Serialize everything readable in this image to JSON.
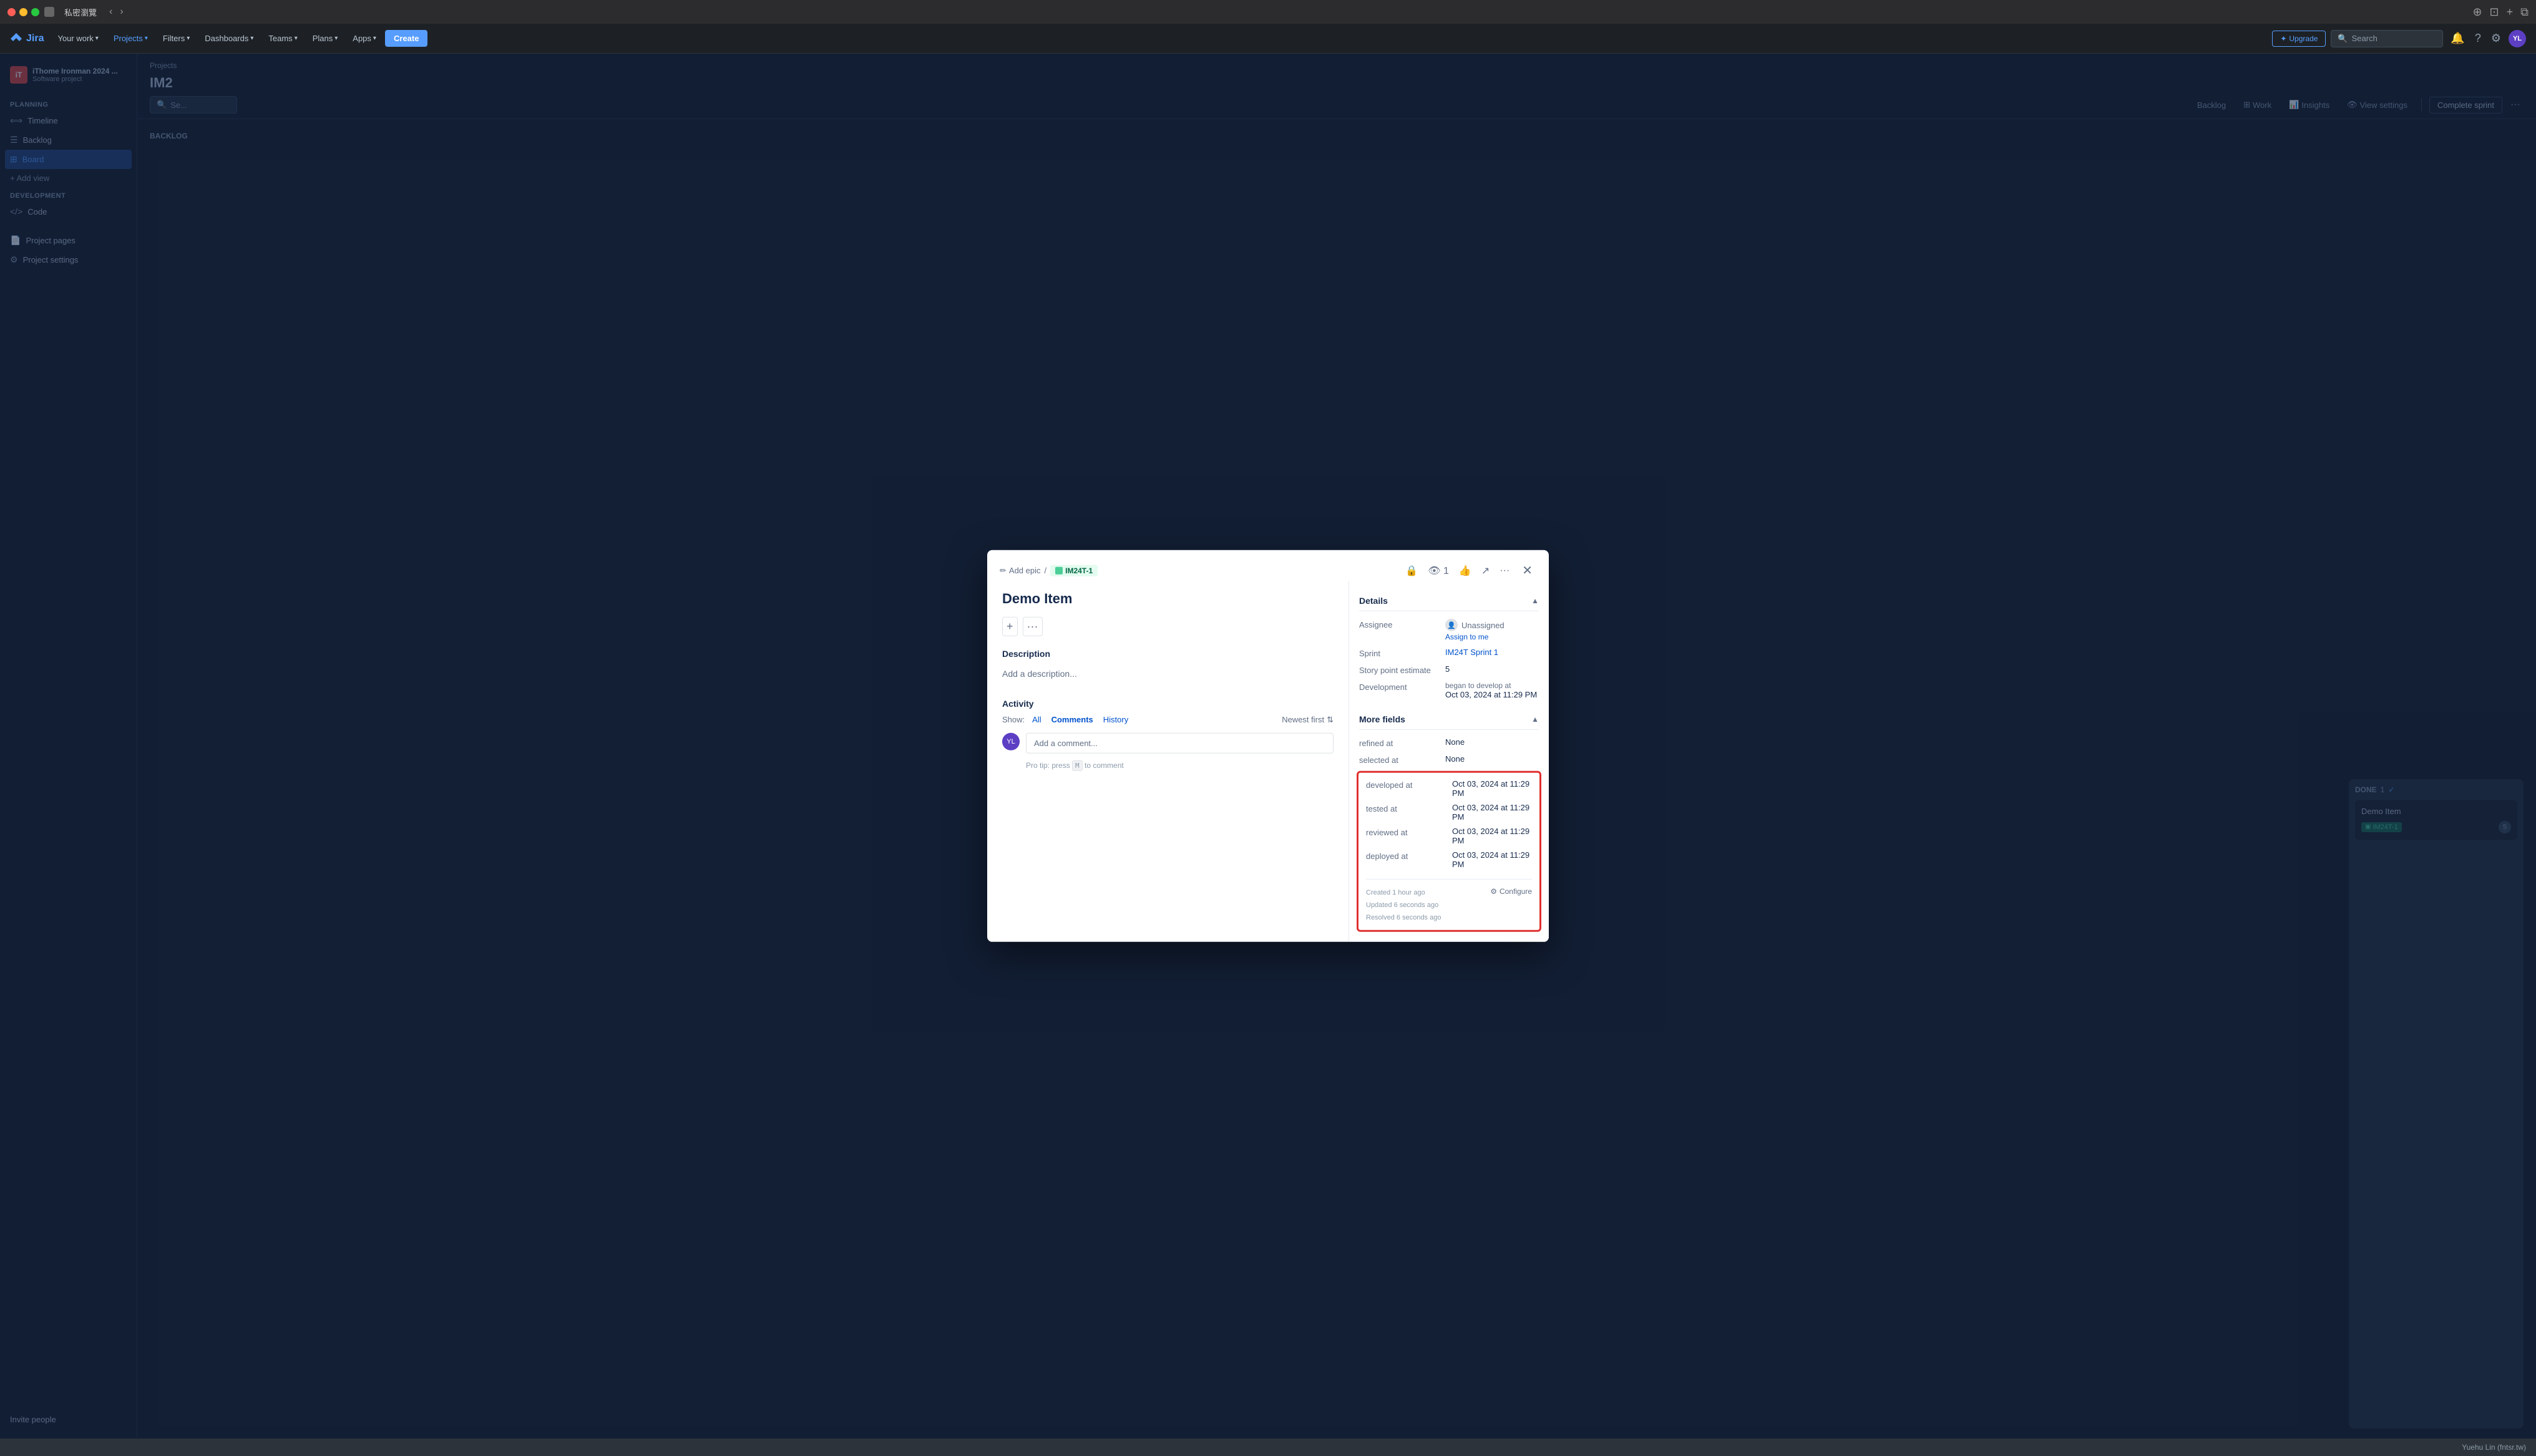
{
  "titlebar": {
    "title": "私密瀏覽",
    "nav_back": "‹",
    "nav_forward": "›"
  },
  "topnav": {
    "logo": "Jira",
    "items": [
      {
        "label": "Your work",
        "has_arrow": true
      },
      {
        "label": "Projects",
        "has_arrow": true,
        "active": true
      },
      {
        "label": "Filters",
        "has_arrow": true
      },
      {
        "label": "Dashboards",
        "has_arrow": true
      },
      {
        "label": "Teams",
        "has_arrow": true
      },
      {
        "label": "Plans",
        "has_arrow": true
      },
      {
        "label": "Apps",
        "has_arrow": true
      }
    ],
    "create_label": "Create",
    "upgrade_label": "Upgrade",
    "search_placeholder": "Search"
  },
  "sidebar": {
    "project_name": "iThome Ironman 2024 ...",
    "project_type": "Software project",
    "planning_label": "PLANNING",
    "items": [
      {
        "label": "Timeline",
        "icon": "timeline"
      },
      {
        "label": "Backlog",
        "icon": "backlog"
      },
      {
        "label": "Board",
        "icon": "board",
        "active": true
      }
    ],
    "add_view_label": "+ Add view",
    "development_label": "DEVELOPMENT",
    "dev_items": [
      {
        "label": "Code",
        "icon": "code"
      }
    ],
    "project_pages_label": "Project pages",
    "project_settings_label": "Project settings",
    "invite_label": "Invite people"
  },
  "board": {
    "breadcrumb": "Projects",
    "title": "IM2",
    "toolbar": {
      "search_placeholder": "Se...",
      "complete_sprint": "Complete sprint"
    },
    "sub_toolbar": {
      "backlog_label": "Backlog",
      "work_label": "Work",
      "insights_label": "Insights",
      "view_settings_label": "View settings"
    },
    "columns": [
      {
        "title": "DONE",
        "count": "1",
        "check": "✓",
        "cards": [
          {
            "title": "Demo Item",
            "tag": "IM24T-1",
            "points": "5"
          }
        ]
      }
    ]
  },
  "modal": {
    "breadcrumb_add_epic": "Add epic",
    "breadcrumb_issue_id": "IM24T-1",
    "issue_tag_color": "#006644",
    "issue_tag_bg": "#e3fcef",
    "title": "Demo Item",
    "description_label": "Description",
    "description_placeholder": "Add a description...",
    "toolbar_plus": "+",
    "toolbar_dots": "···",
    "activity": {
      "label": "Activity",
      "show_label": "Show:",
      "filters": [
        {
          "label": "All",
          "active": false
        },
        {
          "label": "Comments",
          "active": true
        },
        {
          "label": "History",
          "active": false
        }
      ],
      "newest_first": "Newest first",
      "comment_placeholder": "Add a comment..."
    },
    "pro_tip": "Pro tip: press",
    "pro_tip_key": "M",
    "pro_tip_suffix": "to comment",
    "actions": {
      "watch_count": "1",
      "icons": [
        "lock",
        "eye",
        "thumbsup",
        "share",
        "more",
        "close"
      ]
    },
    "details": {
      "section_title": "Details",
      "fields": [
        {
          "label": "Assignee",
          "value": "Unassigned",
          "assign_to_me": "Assign to me"
        },
        {
          "label": "Sprint",
          "value": "IM24T Sprint 1",
          "is_link": true
        },
        {
          "label": "Story point estimate",
          "value": "5"
        },
        {
          "label": "Development",
          "value": "began to develop at",
          "dev_date": "Oct 03, 2024 at 11:29 PM"
        }
      ]
    },
    "more_fields": {
      "section_title": "More fields",
      "fields": [
        {
          "label": "refined at",
          "value": "None"
        },
        {
          "label": "selected at",
          "value": "None"
        },
        {
          "label": "developed at",
          "value": "Oct 03, 2024 at 11:29 PM",
          "highlighted": true
        },
        {
          "label": "tested at",
          "value": "Oct 03, 2024 at 11:29 PM",
          "highlighted": true
        },
        {
          "label": "reviewed at",
          "value": "Oct 03, 2024 at 11:29 PM",
          "highlighted": true
        },
        {
          "label": "deployed at",
          "value": "Oct 03, 2024 at 11:29 PM",
          "highlighted": true
        }
      ]
    },
    "timestamps": {
      "created": "Created 1 hour ago",
      "updated": "Updated 6 seconds ago",
      "resolved": "Resolved 6 seconds ago"
    },
    "configure_label": "Configure"
  },
  "statusbar": {
    "user": "Yuehu Lin (fntsr.tw)"
  }
}
